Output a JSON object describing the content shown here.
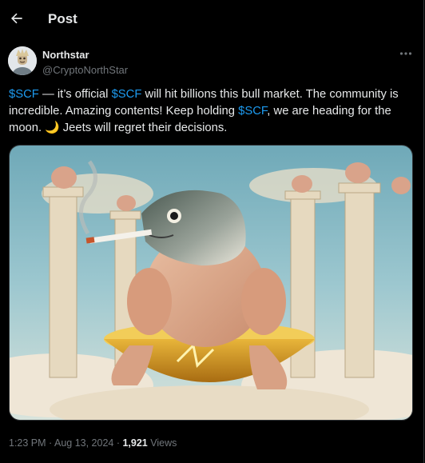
{
  "header": {
    "back_icon": "arrow-left-icon",
    "title": "Post"
  },
  "author": {
    "name": "Northstar",
    "handle": "@CryptoNorthStar"
  },
  "menu": {
    "more_icon": "more-horizontal-icon"
  },
  "post": {
    "segments": [
      {
        "text": "$SCF",
        "cashtag": true
      },
      {
        "text": " — it’s official ",
        "cashtag": false
      },
      {
        "text": "$SCF",
        "cashtag": true
      },
      {
        "text": " will hit billions this bull market. The community is incredible. Amazing contents!  Keep holding ",
        "cashtag": false
      },
      {
        "text": "$SCF",
        "cashtag": true
      },
      {
        "text": ", we are heading for the moon. 🌙  Jeets will regret their decisions.",
        "cashtag": false
      }
    ]
  },
  "meta": {
    "time": "1:23 PM",
    "separator1": " · ",
    "date": "Aug 13, 2024",
    "separator2": " · ",
    "views_count": "1,921",
    "views_label": " Views"
  },
  "colors": {
    "background": "#000000",
    "text": "#e7e9ea",
    "secondary": "#71767b",
    "accent": "#1d9bf0",
    "border": "#2f3336"
  }
}
